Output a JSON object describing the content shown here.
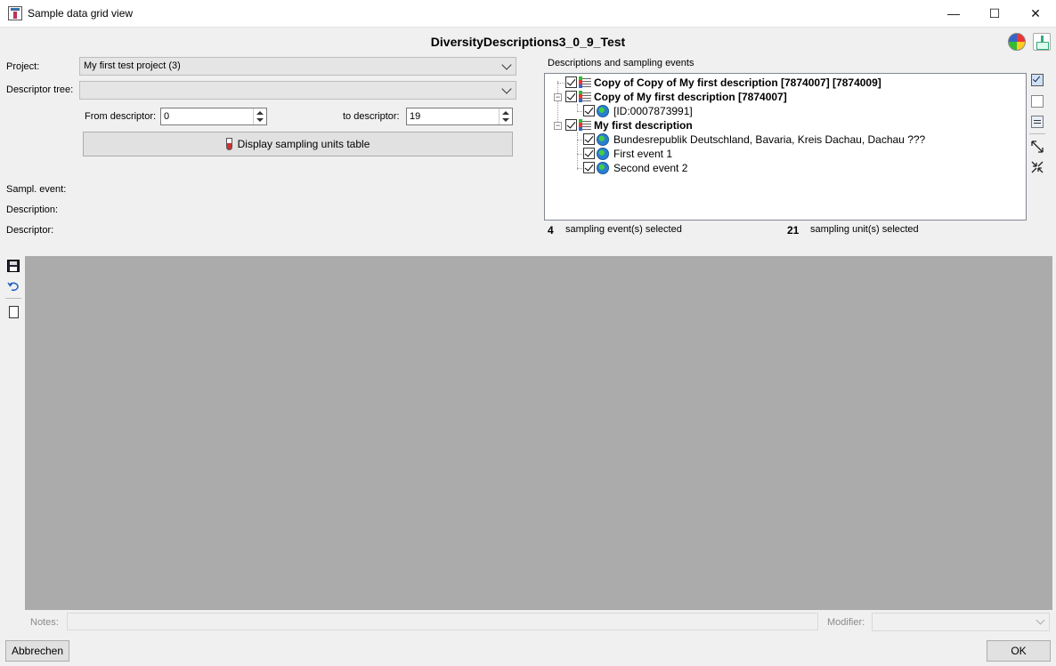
{
  "window": {
    "title": "Sample data grid view",
    "controls": {
      "minimize": "—",
      "maximize": "☐",
      "close": "✕"
    }
  },
  "header": {
    "database_title": "DiversityDescriptions3_0_9_Test",
    "icons": [
      "color-wheel-icon",
      "export-icon"
    ]
  },
  "form": {
    "project_label": "Project:",
    "project_value": "My first test project (3)",
    "descriptor_tree_label": "Descriptor tree:",
    "descriptor_tree_value": "",
    "from_descriptor_label": "From descriptor:",
    "from_descriptor_value": "0",
    "to_descriptor_label": "to descriptor:",
    "to_descriptor_value": "19",
    "display_button_label": "Display sampling units table",
    "sampl_event_label": "Sampl. event:",
    "description_label": "Description:",
    "descriptor_label": "Descriptor:"
  },
  "tree_panel": {
    "group_title": "Descriptions and sampling events",
    "items": [
      {
        "label": "Copy of Copy of My first description [7874007] [7874009]",
        "level": 0,
        "bold": true,
        "checked": true,
        "icon": "description-icon"
      },
      {
        "label": "Copy of My first description [7874007]",
        "level": 0,
        "bold": true,
        "checked": true,
        "icon": "description-icon"
      },
      {
        "label": "[ID:0007873991]",
        "level": 1,
        "bold": false,
        "checked": true,
        "icon": "globe-icon"
      },
      {
        "label": "My first description",
        "level": 0,
        "bold": true,
        "checked": true,
        "icon": "description-icon"
      },
      {
        "label": "Bundesrepublik Deutschland, Bavaria, Kreis Dachau, Dachau ???",
        "level": 1,
        "bold": false,
        "checked": true,
        "icon": "globe-icon"
      },
      {
        "label": "First event 1",
        "level": 1,
        "bold": false,
        "checked": true,
        "icon": "globe-icon"
      },
      {
        "label": "Second event 2",
        "level": 1,
        "bold": false,
        "checked": true,
        "icon": "globe-icon"
      }
    ],
    "events_selected_count": "4",
    "events_selected_label": "sampling event(s) selected",
    "units_selected_count": "21",
    "units_selected_label": "sampling unit(s) selected"
  },
  "bottom": {
    "notes_label": "Notes:",
    "modifier_label": "Modifier:",
    "cancel_label": "Abbrechen",
    "ok_label": "OK"
  }
}
